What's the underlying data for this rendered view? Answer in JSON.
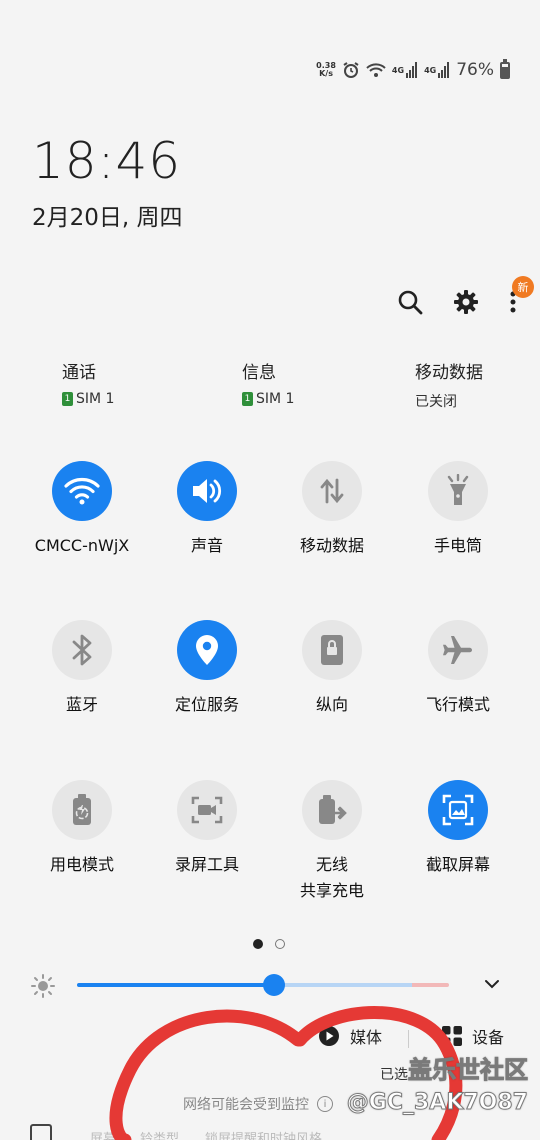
{
  "status": {
    "net_speed_value": "0.38",
    "net_speed_unit": "K/s",
    "net_type_1": "4G",
    "net_type_2": "4G",
    "battery": "76%"
  },
  "clock": {
    "time": "18:46",
    "date": "2月20日, 周四"
  },
  "top_icons": {
    "new_badge": "新"
  },
  "sim_row": [
    {
      "title": "通话",
      "sub": "SIM 1",
      "sim_badge": "1"
    },
    {
      "title": "信息",
      "sub": "SIM 1",
      "sim_badge": "1"
    },
    {
      "title": "移动数据",
      "sub": "已关闭"
    }
  ],
  "tiles": [
    {
      "label": "CMCC-nWjX",
      "icon": "wifi-icon",
      "on": true
    },
    {
      "label": "声音",
      "icon": "sound-icon",
      "on": true
    },
    {
      "label": "移动数据",
      "icon": "mobile-data-icon",
      "on": false
    },
    {
      "label": "手电筒",
      "icon": "flashlight-icon",
      "on": false
    },
    {
      "label": "蓝牙",
      "icon": "bluetooth-icon",
      "on": false
    },
    {
      "label": "定位服务",
      "icon": "location-icon",
      "on": true
    },
    {
      "label": "纵向",
      "icon": "portrait-icon",
      "on": false
    },
    {
      "label": "飞行模式",
      "icon": "airplane-icon",
      "on": false
    },
    {
      "label": "用电模式",
      "icon": "power-mode-icon",
      "on": false
    },
    {
      "label": "录屏工具",
      "icon": "screen-record-icon",
      "on": false
    },
    {
      "label": "无线\n共享充电",
      "label_line1": "无线",
      "label_line2": "共享充电",
      "icon": "wireless-share-icon",
      "on": false
    },
    {
      "label": "截取屏幕",
      "icon": "screenshot-icon",
      "on": true
    }
  ],
  "pager": {
    "pages": 2,
    "current": 1
  },
  "brightness": {
    "level": 0.53
  },
  "bottom": {
    "media_label": "媒体",
    "devices_label": "设备",
    "sub_text": "已选...",
    "monitor_note": "网络可能会受到监控",
    "info_glyph": "i"
  },
  "background_strip": {
    "left_text": "屏幕",
    "mid_text": "铃类型",
    "right_text": "锁屏提醒和时钟风格"
  },
  "watermark": {
    "line1": "盖乐世社区",
    "line2": "@GC_3AK7O87"
  },
  "colors": {
    "accent": "#1a82f0",
    "badge": "#f07a22",
    "annotation": "#e53935"
  }
}
